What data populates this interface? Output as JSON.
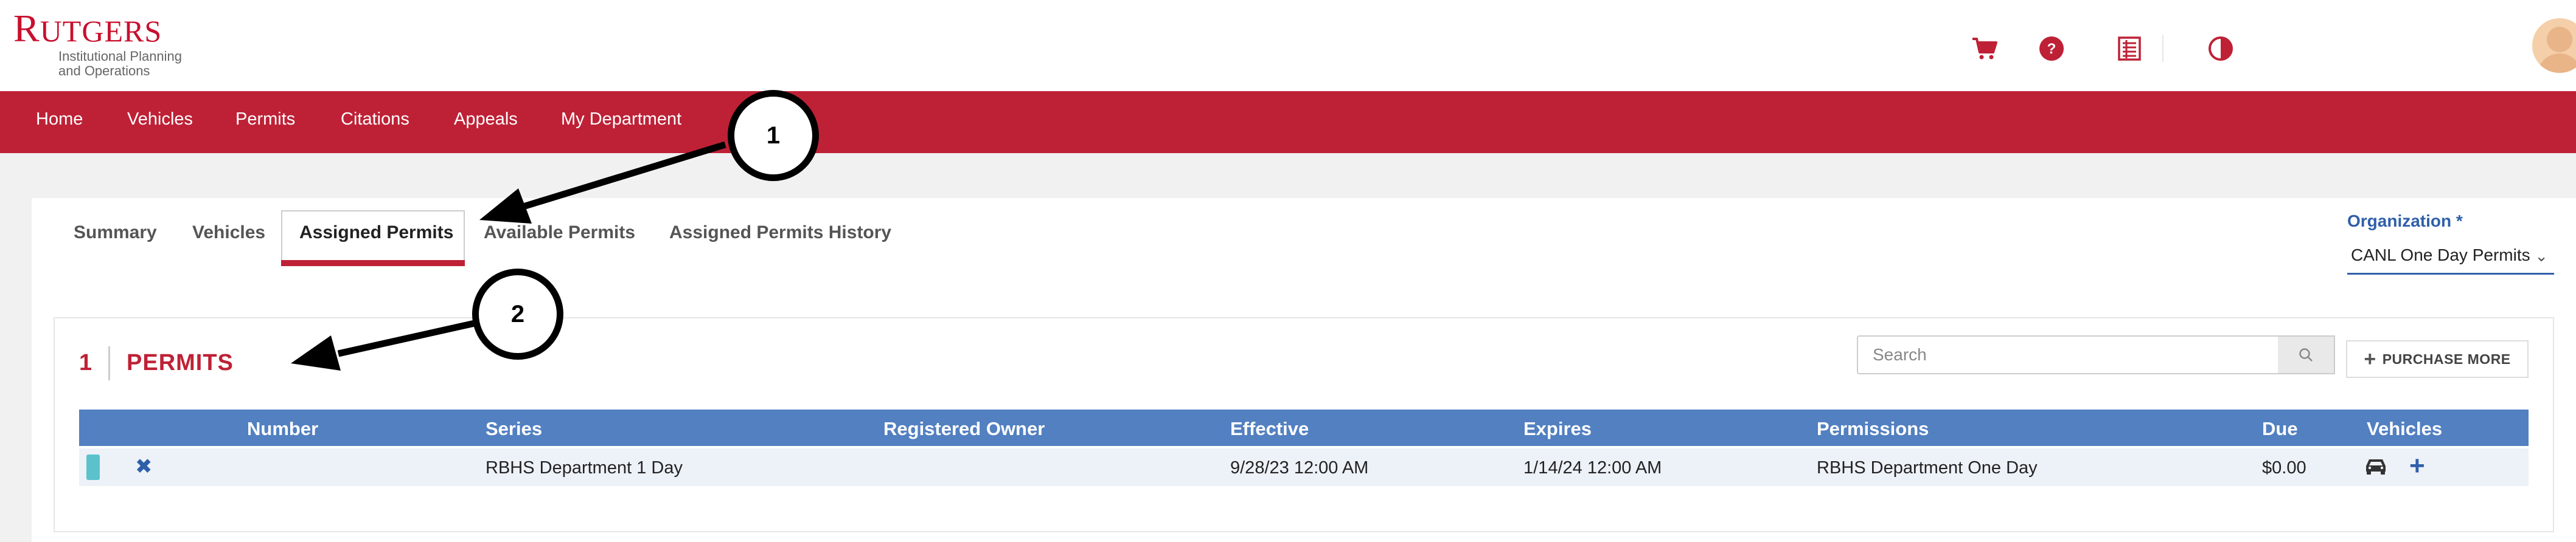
{
  "header": {
    "logo_wordmark": "Rutgers",
    "logo_subtitle_line1": "Institutional Planning",
    "logo_subtitle_line2": "and Operations"
  },
  "icons": {
    "cart": "cart-icon",
    "help": "help-icon",
    "receipt": "receipt-icon",
    "contrast": "contrast-icon",
    "avatar": "avatar-icon"
  },
  "nav": {
    "items": [
      "Home",
      "Vehicles",
      "Permits",
      "Citations",
      "Appeals",
      "My Department"
    ]
  },
  "tabs": [
    "Summary",
    "Vehicles",
    "Assigned Permits",
    "Available Permits",
    "Assigned Permits History"
  ],
  "active_tab": "Assigned Permits",
  "organization": {
    "label": "Organization *",
    "selected": "CANL One Day Permits"
  },
  "permits_section": {
    "count": "1",
    "title": "PERMITS"
  },
  "search": {
    "placeholder": "Search",
    "value": ""
  },
  "purchase_more": "PURCHASE MORE",
  "table": {
    "columns": [
      "Number",
      "Series",
      "Registered Owner",
      "Effective",
      "Expires",
      "Permissions",
      "Due",
      "Vehicles"
    ],
    "rows": [
      {
        "number": "",
        "series": "RBHS Department 1 Day",
        "registered_owner": "",
        "effective": "9/28/23 12:00 AM",
        "expires": "1/14/24 12:00 AM",
        "permissions": "RBHS Department One Day",
        "due": "$0.00",
        "color": "#5bc2cc"
      }
    ]
  },
  "annotations": {
    "callout_1": "1",
    "callout_2": "2"
  },
  "colors": {
    "brand_red": "#be2136",
    "table_header": "#5280c1",
    "link_blue": "#2f5fa9"
  }
}
